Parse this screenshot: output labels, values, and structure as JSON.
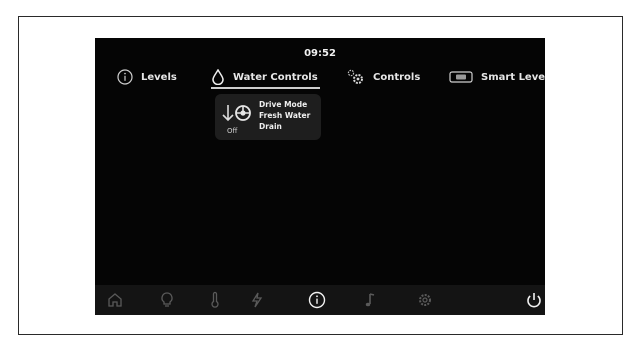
{
  "status": {
    "time": "09:52"
  },
  "tabs": [
    {
      "label": "Levels",
      "icon": "info-icon",
      "active": false
    },
    {
      "label": "Water Controls",
      "icon": "water-drop-icon",
      "active": true
    },
    {
      "label": "Controls",
      "icon": "gears-icon",
      "active": false
    },
    {
      "label": "Smart Level",
      "icon": "level-icon",
      "active": false
    }
  ],
  "drain_popup": {
    "icon": "drain-valve-icon",
    "state": "Off",
    "lines": [
      "Drive Mode",
      "Fresh Water",
      "Drain"
    ]
  },
  "bottom_nav": {
    "items": [
      "home-icon",
      "bulb-icon",
      "thermometer-icon",
      "lightning-icon",
      "info-icon",
      "music-note-icon",
      "gear-icon",
      "power-icon"
    ],
    "active": "info-icon"
  },
  "colors": {
    "screen_bg": "#050505",
    "bar_bg": "#141414",
    "popup_bg": "#1e1e1e",
    "text": "#e9e9e9",
    "dim_icon": "#5a5a5a"
  }
}
